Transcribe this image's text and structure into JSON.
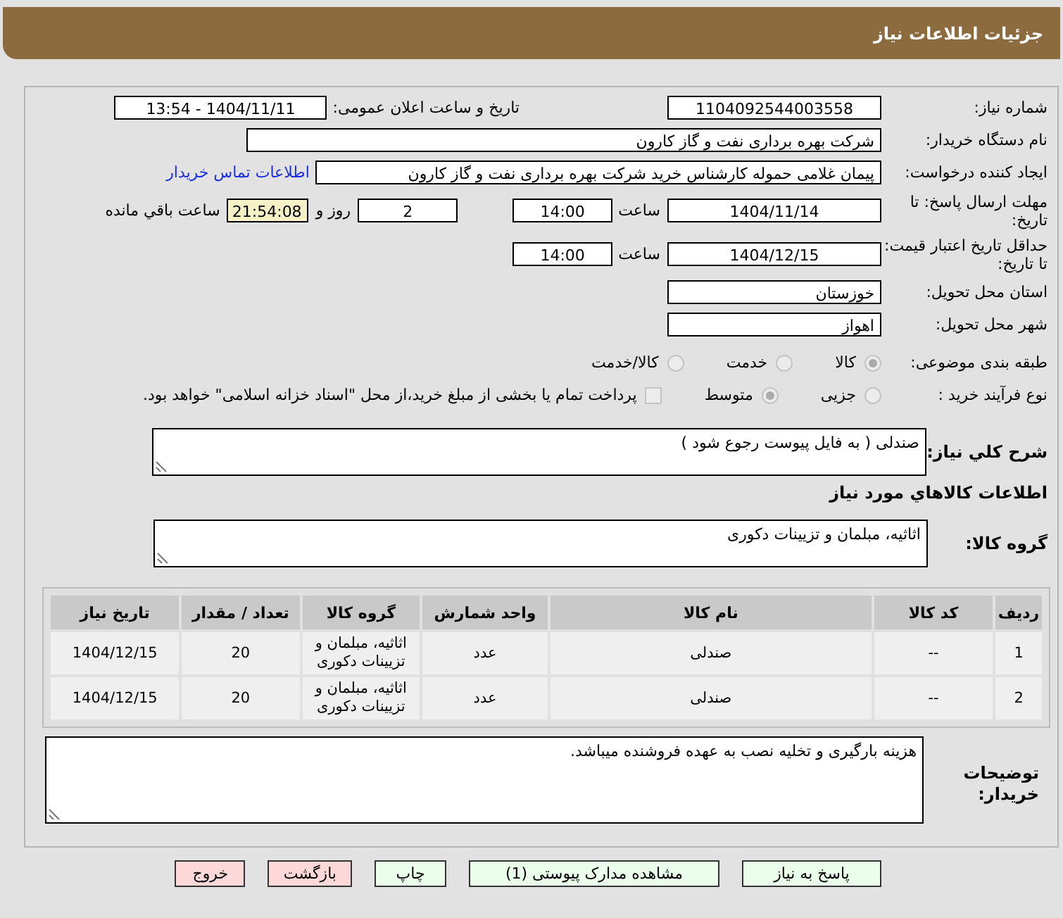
{
  "header": {
    "title": "جزئیات اطلاعات نیاز"
  },
  "need_number": {
    "label": "شماره نیاز:",
    "value": "1104092544003558"
  },
  "announce": {
    "label": "تاریخ و ساعت اعلان عمومی:",
    "value": "1404/11/11 - 13:54"
  },
  "buyer_org": {
    "label": "نام دستگاه خریدار:",
    "value": "شرکت بهره برداری نفت و گاز کارون"
  },
  "requester": {
    "label": "ایجاد کننده درخواست:",
    "value": "پیمان غلامی حموله کارشناس خرید شرکت بهره برداری نفت و گاز کارون",
    "link": "اطلاعات تماس خریدار"
  },
  "reply_deadline": {
    "label": "مهلت ارسال پاسخ: تا تاریخ:",
    "date": "1404/11/14",
    "time_label": "ساعت",
    "time": "14:00",
    "days": "2",
    "days_label": "روز و",
    "remaining": "21:54:08",
    "remaining_label": "ساعت باقي مانده"
  },
  "price_validity": {
    "label": "حداقل تاریخ اعتبار قیمت: تا تاریخ:",
    "date": "1404/12/15",
    "time_label": "ساعت",
    "time": "14:00"
  },
  "province": {
    "label": "استان محل تحویل:",
    "value": "خوزستان"
  },
  "city": {
    "label": "شهر محل تحویل:",
    "value": "اهواز"
  },
  "category": {
    "label": "طبقه بندی موضوعی:",
    "options": [
      {
        "label": "کالا",
        "selected": true
      },
      {
        "label": "خدمت",
        "selected": false
      },
      {
        "label": "کالا/خدمت",
        "selected": false
      }
    ]
  },
  "process": {
    "label": "نوع فرآیند خرید :",
    "options": [
      {
        "label": "جزیی",
        "selected": false
      },
      {
        "label": "متوسط",
        "selected": true
      }
    ],
    "payment": {
      "label": "پرداخت تمام یا بخشی از مبلغ خرید،از محل \"اسناد خزانه اسلامی\" خواهد بود.",
      "checked": false
    }
  },
  "description": {
    "label": "شرح کلي نياز:",
    "value": "صندلی ( به فایل پیوست رجوع شود )"
  },
  "goods_title": "اطلاعات کالاهاي مورد نياز",
  "goods_group": {
    "label": "گروه کالا:",
    "value": "اثاثیه، مبلمان و تزیینات دکوری"
  },
  "table": {
    "columns": [
      "ردیف",
      "کد کالا",
      "نام کالا",
      "واحد شمارش",
      "گروه کالا",
      "تعداد / مقدار",
      "تاریخ نیاز"
    ],
    "rows": [
      [
        "1",
        "--",
        "صندلی",
        "عدد",
        "اثاثیه، مبلمان و تزیینات دکوری",
        "20",
        "1404/12/15"
      ],
      [
        "2",
        "--",
        "صندلی",
        "عدد",
        "اثاثیه، مبلمان و تزیینات دکوری",
        "20",
        "1404/12/15"
      ]
    ]
  },
  "buyer_notes": {
    "label": "توضیحات خریدار:",
    "value": "هزینه بارگیری و تخلیه نصب به عهده فروشنده میباشد."
  },
  "buttons": [
    {
      "label": "پاسخ به نیاز",
      "kind": "normal"
    },
    {
      "label": "مشاهده مدارک پیوستی (1)",
      "kind": "normal"
    },
    {
      "label": "چاپ",
      "kind": "normal"
    },
    {
      "label": "بازگشت",
      "kind": "danger"
    },
    {
      "label": "خروج",
      "kind": "danger"
    }
  ]
}
